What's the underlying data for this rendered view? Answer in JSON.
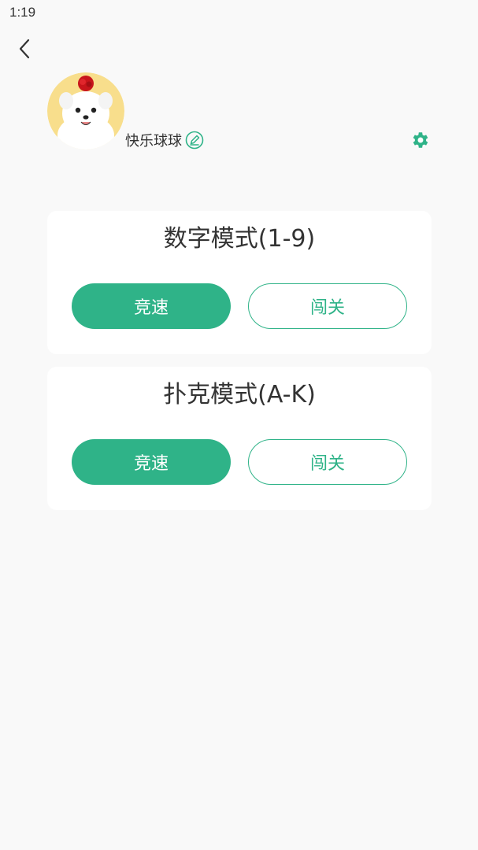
{
  "status_bar": {
    "time": "1:19"
  },
  "icons": {
    "back": "chevron-left-icon",
    "edit": "edit-icon",
    "settings": "gear-icon"
  },
  "colors": {
    "accent": "#2fb388",
    "background": "#f9f9f9",
    "card": "#ffffff"
  },
  "profile": {
    "username": "快乐球球"
  },
  "modes": [
    {
      "title": "数字模式(1-9)",
      "primary_label": "竞速",
      "secondary_label": "闯关"
    },
    {
      "title": "扑克模式(A-K)",
      "primary_label": "竞速",
      "secondary_label": "闯关"
    }
  ]
}
